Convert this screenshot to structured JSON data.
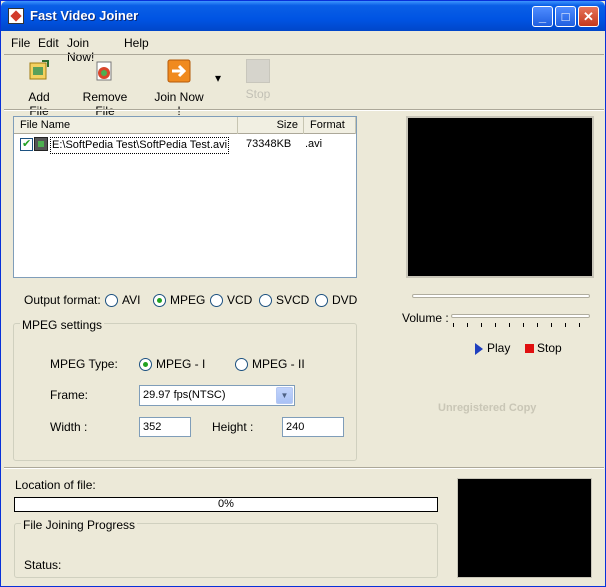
{
  "window": {
    "title": "Fast Video Joiner",
    "minimize_label": "_",
    "maximize_label": "□",
    "close_label": "✕"
  },
  "menu": [
    "File",
    "Edit",
    "Join Now!",
    "Help"
  ],
  "toolbar": {
    "add_file": "Add File",
    "remove_file": "Remove File",
    "join_now": "Join Now !",
    "dropdown": "▾",
    "stop": "Stop"
  },
  "file_list": {
    "headers": [
      "File Name",
      "Size",
      "Format"
    ],
    "rows": [
      {
        "name": "E:\\SoftPedia Test\\SoftPedia Test.avi",
        "size": "73348KB",
        "format": ".avi",
        "checked": true
      }
    ]
  },
  "output_format": {
    "label": "Output format:",
    "options": [
      "AVI",
      "MPEG",
      "VCD",
      "SVCD",
      "DVD"
    ],
    "selected": "MPEG"
  },
  "mpeg_settings": {
    "title": "MPEG settings",
    "type_label": "MPEG Type:",
    "type_options": [
      "MPEG - I",
      "MPEG - II"
    ],
    "type_selected": "MPEG - I",
    "frame_label": "Frame:",
    "frame_value": "29.97 fps(NTSC)",
    "width_label": "Width :",
    "width_value": "352",
    "height_label": "Height :",
    "height_value": "240"
  },
  "player": {
    "volume_label": "Volume :",
    "play_label": "Play",
    "stop_label": "Stop",
    "watermark": "Unregistered Copy"
  },
  "bottom": {
    "location_label": "Location of file:",
    "progress_text": "0%",
    "progress_value": 0,
    "group_title": "File Joining Progress",
    "status_label": "Status:"
  },
  "colors": {
    "titlebar": "#0054e3",
    "window_bg": "#ece9d8",
    "video_bg": "#000000",
    "accent_play": "#1f3fbf",
    "accent_stop": "#e01010"
  }
}
